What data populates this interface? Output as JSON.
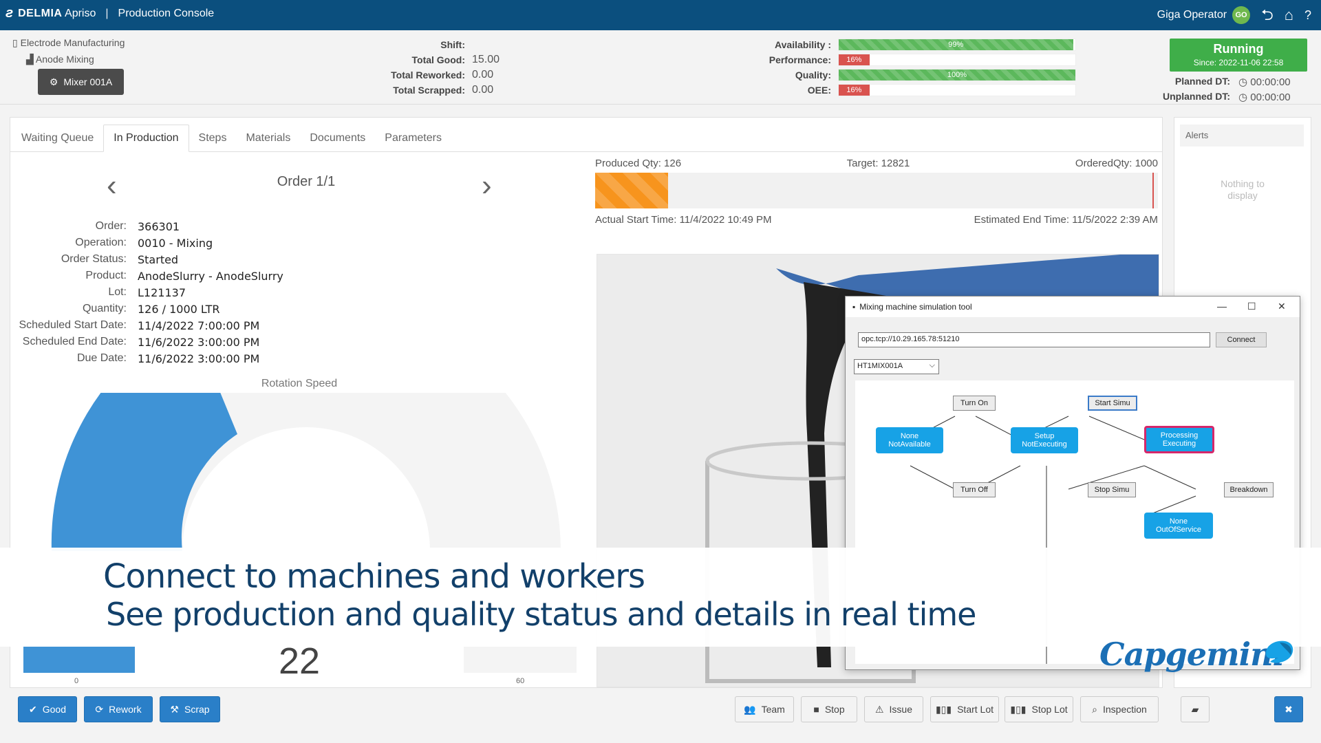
{
  "header": {
    "brand": "DELMIA Apriso",
    "brand_strong": "DELMIA",
    "brand_rest": "Apriso",
    "app_title": "Production Console",
    "user_name": "Giga Operator",
    "user_initials": "GO"
  },
  "location": {
    "site": "Electrode Manufacturing",
    "area": "Anode Mixing",
    "machine_button": "Mixer 001A"
  },
  "counts": [
    {
      "label": "Shift:",
      "value": ""
    },
    {
      "label": "Total Good:",
      "value": "15.00"
    },
    {
      "label": "Total Reworked:",
      "value": "0.00"
    },
    {
      "label": "Total Scrapped:",
      "value": "0.00"
    }
  ],
  "kpis": [
    {
      "label": "Availability :",
      "value_text": "99%",
      "value": 0.99,
      "color": "#5cb85c"
    },
    {
      "label": "Performance:",
      "value_text": "16%",
      "value": 0.13,
      "color": "#d9534f"
    },
    {
      "label": "Quality:",
      "value_text": "100%",
      "value": 1.0,
      "color": "#5cb85c"
    },
    {
      "label": "OEE:",
      "value_text": "16%",
      "value": 0.13,
      "color": "#d9534f"
    }
  ],
  "status": {
    "state": "Running",
    "since": "Since: 2022-11-06 22:58",
    "planned_dt_label": "Planned DT:",
    "planned_dt": "00:00:00",
    "unplanned_dt_label": "Unplanned DT:",
    "unplanned_dt": "00:00:00"
  },
  "tabs": [
    "Waiting Queue",
    "In Production",
    "Steps",
    "Materials",
    "Documents",
    "Parameters"
  ],
  "order": {
    "nav": "Order 1/1",
    "fields": [
      {
        "label": "Order:",
        "value": "366301"
      },
      {
        "label": "Operation:",
        "value": "0010 - Mixing"
      },
      {
        "label": "Order Status:",
        "value": "Started"
      },
      {
        "label": "Product:",
        "value": "AnodeSlurry - AnodeSlurry"
      },
      {
        "label": "Lot:",
        "value": "L121137"
      },
      {
        "label": "Quantity:",
        "value": "126 / 1000 LTR"
      },
      {
        "label": "Scheduled Start Date:",
        "value": "11/4/2022 7:00:00 PM"
      },
      {
        "label": "Scheduled End Date:",
        "value": "11/6/2022 3:00:00 PM"
      },
      {
        "label": "Due Date:",
        "value": "11/6/2022 3:00:00 PM"
      }
    ]
  },
  "gauge": {
    "title": "Rotation Speed",
    "value": "22",
    "min": "0",
    "max": "60"
  },
  "progress": {
    "produced": "Produced Qty: 126",
    "target": "Target: 12821",
    "ordered": "OrderedQty: 1000",
    "actual_start": "Actual Start Time: 11/4/2022 10:49 PM",
    "estimated_end": "Estimated End Time: 11/5/2022 2:39 AM"
  },
  "alerts": {
    "title": "Alerts",
    "empty_line1": "Nothing to",
    "empty_line2": "display"
  },
  "sim": {
    "title": "Mixing machine simulation tool",
    "url": "opc.tcp://10.29.165.78:51210",
    "connect": "Connect",
    "machine": "HT1MIX001A",
    "nodes": {
      "turn_on": "Turn On",
      "start_simu": "Start Simu",
      "none_na_1": "None",
      "none_na_2": "NotAvailable",
      "setup_1": "Setup",
      "setup_2": "NotExecuting",
      "proc_1": "Processing",
      "proc_2": "Executing",
      "turn_off": "Turn Off",
      "stop_simu": "Stop Simu",
      "breakdown": "Breakdown",
      "oos_1": "None",
      "oos_2": "OutOfService"
    }
  },
  "caption": {
    "line1": "Connect to machines and workers",
    "line2": "See production and quality status and details in real time",
    "logo": "Capgemini"
  },
  "buttons": {
    "good": "Good",
    "rework": "Rework",
    "scrap": "Scrap",
    "team": "Team",
    "stop": "Stop",
    "issue": "Issue",
    "start_lot": "Start Lot",
    "stop_lot": "Stop Lot",
    "inspection": "Inspection"
  }
}
